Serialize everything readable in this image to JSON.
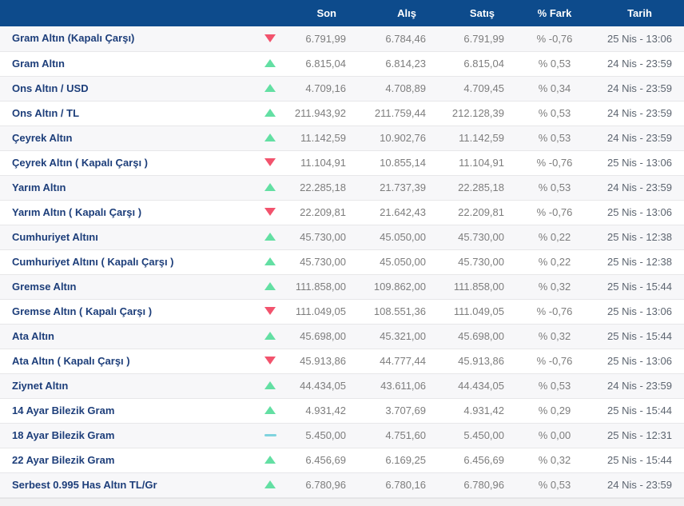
{
  "table": {
    "columns": [
      "Son",
      "Alış",
      "Satış",
      "% Fark",
      "Tarih"
    ],
    "rows": [
      {
        "name": "Gram Altın (Kapalı Çarşı)",
        "trend": "down",
        "son": "6.791,99",
        "alis": "6.784,46",
        "satis": "6.791,99",
        "fark": "% -0,76",
        "tarih": "25 Nis - 13:06"
      },
      {
        "name": "Gram Altın",
        "trend": "up",
        "son": "6.815,04",
        "alis": "6.814,23",
        "satis": "6.815,04",
        "fark": "% 0,53",
        "tarih": "24 Nis - 23:59"
      },
      {
        "name": "Ons Altın / USD",
        "trend": "up",
        "son": "4.709,16",
        "alis": "4.708,89",
        "satis": "4.709,45",
        "fark": "% 0,34",
        "tarih": "24 Nis - 23:59"
      },
      {
        "name": "Ons Altın / TL",
        "trend": "up",
        "son": "211.943,92",
        "alis": "211.759,44",
        "satis": "212.128,39",
        "fark": "% 0,53",
        "tarih": "24 Nis - 23:59"
      },
      {
        "name": "Çeyrek Altın",
        "trend": "up",
        "son": "11.142,59",
        "alis": "10.902,76",
        "satis": "11.142,59",
        "fark": "% 0,53",
        "tarih": "24 Nis - 23:59"
      },
      {
        "name": "Çeyrek Altın ( Kapalı Çarşı )",
        "trend": "down",
        "son": "11.104,91",
        "alis": "10.855,14",
        "satis": "11.104,91",
        "fark": "% -0,76",
        "tarih": "25 Nis - 13:06"
      },
      {
        "name": "Yarım Altın",
        "trend": "up",
        "son": "22.285,18",
        "alis": "21.737,39",
        "satis": "22.285,18",
        "fark": "% 0,53",
        "tarih": "24 Nis - 23:59"
      },
      {
        "name": "Yarım Altın ( Kapalı Çarşı )",
        "trend": "down",
        "son": "22.209,81",
        "alis": "21.642,43",
        "satis": "22.209,81",
        "fark": "% -0,76",
        "tarih": "25 Nis - 13:06"
      },
      {
        "name": "Cumhuriyet Altını",
        "trend": "up",
        "son": "45.730,00",
        "alis": "45.050,00",
        "satis": "45.730,00",
        "fark": "% 0,22",
        "tarih": "25 Nis - 12:38"
      },
      {
        "name": "Cumhuriyet Altını ( Kapalı Çarşı )",
        "trend": "up",
        "son": "45.730,00",
        "alis": "45.050,00",
        "satis": "45.730,00",
        "fark": "% 0,22",
        "tarih": "25 Nis - 12:38"
      },
      {
        "name": "Gremse Altın",
        "trend": "up",
        "son": "111.858,00",
        "alis": "109.862,00",
        "satis": "111.858,00",
        "fark": "% 0,32",
        "tarih": "25 Nis - 15:44"
      },
      {
        "name": "Gremse Altın ( Kapalı Çarşı )",
        "trend": "down",
        "son": "111.049,05",
        "alis": "108.551,36",
        "satis": "111.049,05",
        "fark": "% -0,76",
        "tarih": "25 Nis - 13:06"
      },
      {
        "name": "Ata Altın",
        "trend": "up",
        "son": "45.698,00",
        "alis": "45.321,00",
        "satis": "45.698,00",
        "fark": "% 0,32",
        "tarih": "25 Nis - 15:44"
      },
      {
        "name": "Ata Altın ( Kapalı Çarşı )",
        "trend": "down",
        "son": "45.913,86",
        "alis": "44.777,44",
        "satis": "45.913,86",
        "fark": "% -0,76",
        "tarih": "25 Nis - 13:06"
      },
      {
        "name": "Ziynet Altın",
        "trend": "up",
        "son": "44.434,05",
        "alis": "43.611,06",
        "satis": "44.434,05",
        "fark": "% 0,53",
        "tarih": "24 Nis - 23:59"
      },
      {
        "name": "14 Ayar Bilezik Gram",
        "trend": "up",
        "son": "4.931,42",
        "alis": "3.707,69",
        "satis": "4.931,42",
        "fark": "% 0,29",
        "tarih": "25 Nis - 15:44"
      },
      {
        "name": "18 Ayar Bilezik Gram",
        "trend": "flat",
        "son": "5.450,00",
        "alis": "4.751,60",
        "satis": "5.450,00",
        "fark": "% 0,00",
        "tarih": "25 Nis - 12:31"
      },
      {
        "name": "22 Ayar Bilezik Gram",
        "trend": "up",
        "son": "6.456,69",
        "alis": "6.169,25",
        "satis": "6.456,69",
        "fark": "% 0,32",
        "tarih": "25 Nis - 15:44"
      },
      {
        "name": "Serbest 0.995 Has Altın TL/Gr",
        "trend": "up",
        "son": "6.780,96",
        "alis": "6.780,16",
        "satis": "6.780,96",
        "fark": "% 0,53",
        "tarih": "24 Nis - 23:59"
      }
    ]
  },
  "colors": {
    "header-bg": "#0d4b8c",
    "name-blue": "#1d3e7a",
    "num-gray": "#7d7d7d",
    "date-gray": "#5d6570",
    "up-green": "#63dfa3",
    "down-red": "#f2536d",
    "flat-cyan": "#7fd3de"
  }
}
